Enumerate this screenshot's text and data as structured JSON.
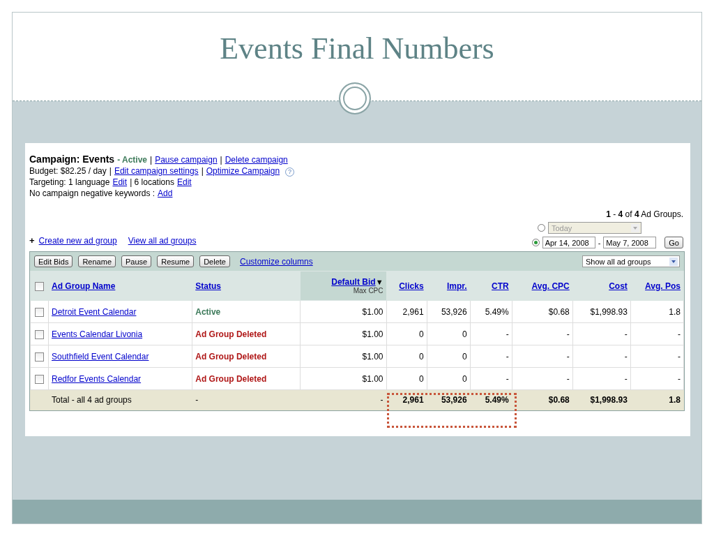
{
  "slide": {
    "title": "Events Final Numbers"
  },
  "campaign": {
    "lines": [
      [
        {
          "kind": "title",
          "text": "Campaign: Events"
        },
        {
          "kind": "status",
          "text": "- Active"
        },
        {
          "kind": "text",
          "text": "|"
        },
        {
          "kind": "link",
          "text": "Pause campaign"
        },
        {
          "kind": "text",
          "text": "|"
        },
        {
          "kind": "link",
          "text": "Delete campaign"
        }
      ],
      [
        {
          "kind": "text",
          "text": "Budget: $82.25 / day"
        },
        {
          "kind": "text",
          "text": "|"
        },
        {
          "kind": "link",
          "text": "Edit campaign settings"
        },
        {
          "kind": "text",
          "text": "|"
        },
        {
          "kind": "link",
          "text": "Optimize Campaign"
        },
        {
          "kind": "help",
          "text": "?"
        }
      ],
      [
        {
          "kind": "text",
          "text": "Targeting: 1 language"
        },
        {
          "kind": "link",
          "text": "Edit"
        },
        {
          "kind": "text",
          "text": "| 6 locations"
        },
        {
          "kind": "link",
          "text": "Edit"
        }
      ],
      [
        {
          "kind": "text",
          "text": "No campaign negative keywords :"
        },
        {
          "kind": "link",
          "text": "Add"
        }
      ]
    ]
  },
  "pager": "**1** - **4** of **4** Ad Groups.",
  "date_range": {
    "preset": {
      "value": "Today",
      "selected": false,
      "disabled": true
    },
    "custom": {
      "start": "Apr 14, 2008",
      "separator": "-",
      "end": "May 7, 2008",
      "selected": true
    },
    "go": "Go"
  },
  "actions": {
    "plus": "+",
    "create": "Create new ad group",
    "view_all": "View all ad groups"
  },
  "toolbar": {
    "buttons": [
      "Edit Bids",
      "Rename",
      "Pause",
      "Resume",
      "Delete"
    ],
    "customize": "Customize columns",
    "filter": "Show all ad groups"
  },
  "table": {
    "header_checked": false,
    "columns": [
      {
        "label": "Ad Group Name",
        "sorted": false
      },
      {
        "label": "Status",
        "sorted": false
      },
      {
        "label": "Default Bid",
        "sort_indicator": "▼",
        "sublabel": "Max CPC",
        "sorted": true
      },
      {
        "label": "Clicks",
        "sorted": false
      },
      {
        "label": "Impr.",
        "sorted": false
      },
      {
        "label": "CTR",
        "sorted": false
      },
      {
        "label": "Avg. CPC",
        "sorted": false
      },
      {
        "label": "Cost",
        "sorted": false
      },
      {
        "label": "Avg. Pos",
        "sorted": false
      }
    ],
    "rows": [
      {
        "checked": false,
        "name": "Detroit Event Calendar",
        "status": "Active",
        "kind": "active",
        "values": [
          "$1.00",
          "2,961",
          "53,926",
          "5.49%",
          "$0.68",
          "$1,998.93",
          "1.8"
        ]
      },
      {
        "checked": false,
        "name": "Events Calendar Livonia",
        "status": "Ad Group Deleted",
        "kind": "deleted",
        "values": [
          "$1.00",
          "0",
          "0",
          "-",
          "-",
          "-",
          "-"
        ]
      },
      {
        "checked": false,
        "name": "Southfield Event Calendar",
        "status": "Ad Group Deleted",
        "kind": "deleted",
        "values": [
          "$1.00",
          "0",
          "0",
          "-",
          "-",
          "-",
          "-"
        ]
      },
      {
        "checked": false,
        "name": "Redfor Events Calendar",
        "status": "Ad Group Deleted",
        "kind": "deleted",
        "values": [
          "$1.00",
          "0",
          "0",
          "-",
          "-",
          "-",
          "-"
        ]
      }
    ],
    "total": {
      "label": "Total - all 4 ad groups",
      "status": "-",
      "values": [
        "-",
        "2,961",
        "53,926",
        "5.49%",
        "$0.68",
        "$1,998.93",
        "1.8"
      ]
    }
  }
}
